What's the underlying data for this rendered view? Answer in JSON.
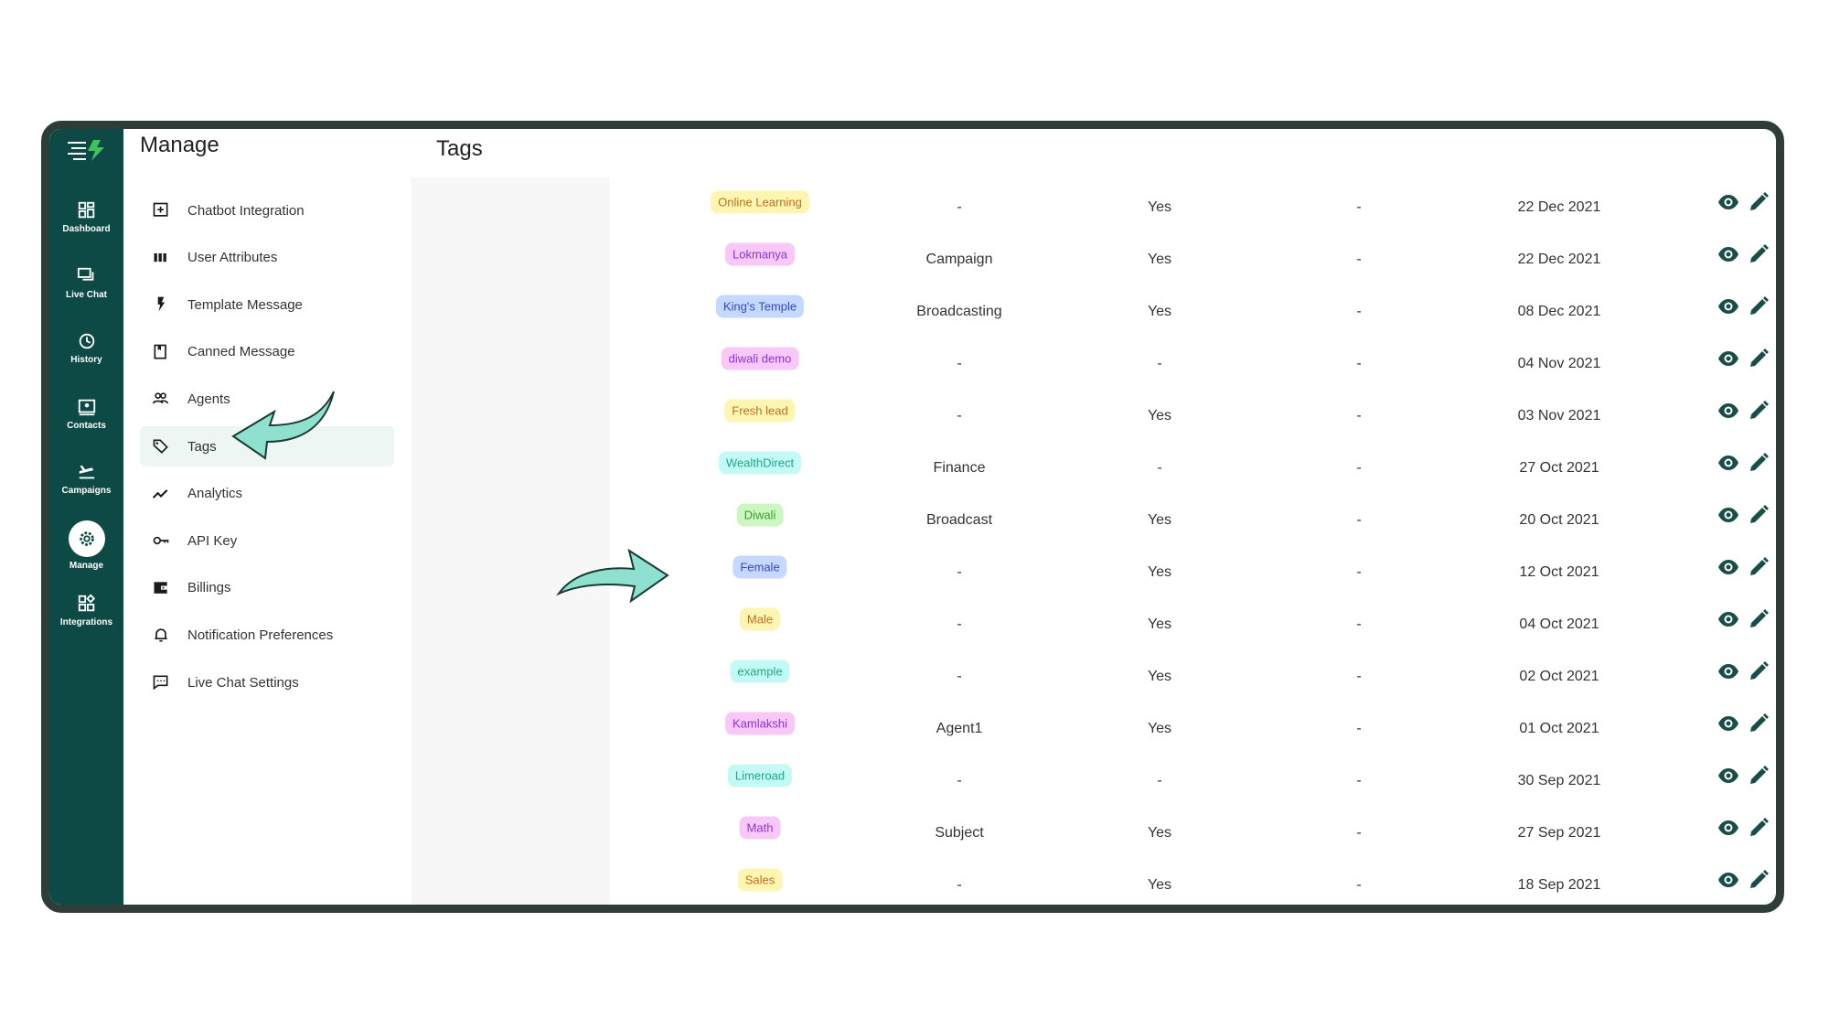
{
  "rail": [
    {
      "label": "Dashboard",
      "icon": "dashboard-icon"
    },
    {
      "label": "Live Chat",
      "icon": "chat-icon"
    },
    {
      "label": "History",
      "icon": "history-icon"
    },
    {
      "label": "Contacts",
      "icon": "contacts-icon"
    },
    {
      "label": "Campaigns",
      "icon": "campaigns-icon"
    },
    {
      "label": "Manage",
      "icon": "gear-icon",
      "active": true
    },
    {
      "label": "Integrations",
      "icon": "integrations-icon"
    }
  ],
  "menu": {
    "title": "Manage",
    "items": [
      {
        "label": "Chatbot Integration",
        "icon": "chatbot-icon"
      },
      {
        "label": "User Attributes",
        "icon": "attributes-icon"
      },
      {
        "label": "Template Message",
        "icon": "bolt-icon"
      },
      {
        "label": "Canned Message",
        "icon": "bookmark-icon"
      },
      {
        "label": "Agents",
        "icon": "agents-icon"
      },
      {
        "label": "Tags",
        "icon": "tag-icon",
        "active": true
      },
      {
        "label": "Analytics",
        "icon": "analytics-icon"
      },
      {
        "label": "API Key",
        "icon": "key-icon"
      },
      {
        "label": "Billings",
        "icon": "wallet-icon"
      },
      {
        "label": "Notification Preferences",
        "icon": "bell-icon"
      },
      {
        "label": "Live Chat Settings",
        "icon": "chat-settings-icon"
      }
    ]
  },
  "page": {
    "title": "Tags"
  },
  "colors": {
    "rail": "#0e4a45",
    "frame": "#2e3d38",
    "icon": "#1a4d47",
    "arrow": "#8fe0cf"
  },
  "tag_styles": {
    "yellow": {
      "bg": "#fdf6b3",
      "fg": "#c0701e"
    },
    "pink": {
      "bg": "#f8c8f8",
      "fg": "#8a35d8"
    },
    "blue": {
      "bg": "#c5d8ff",
      "fg": "#3448c8"
    },
    "cyan": {
      "bg": "#c3faf5",
      "fg": "#1ea98a"
    },
    "green": {
      "bg": "#cdf7c2",
      "fg": "#3b9a2c"
    }
  },
  "rows": [
    {
      "tag": "Online Learning",
      "style": "yellow",
      "c2": "-",
      "c3": "Yes",
      "c4": "-",
      "date": "22 Dec 2021"
    },
    {
      "tag": "Lokmanya",
      "style": "pink",
      "c2": "Campaign",
      "c3": "Yes",
      "c4": "-",
      "date": "22 Dec 2021"
    },
    {
      "tag": "King's Temple",
      "style": "blue",
      "c2": "Broadcasting",
      "c3": "Yes",
      "c4": "-",
      "date": "08 Dec 2021"
    },
    {
      "tag": "diwali demo",
      "style": "pink",
      "c2": "-",
      "c3": "-",
      "c4": "-",
      "date": "04 Nov 2021"
    },
    {
      "tag": "Fresh lead",
      "style": "yellow",
      "c2": "-",
      "c3": "Yes",
      "c4": "-",
      "date": "03 Nov 2021"
    },
    {
      "tag": "WealthDirect",
      "style": "cyan",
      "c2": "Finance",
      "c3": "-",
      "c4": "-",
      "date": "27 Oct 2021"
    },
    {
      "tag": "Diwali",
      "style": "green",
      "c2": "Broadcast",
      "c3": "Yes",
      "c4": "-",
      "date": "20 Oct 2021"
    },
    {
      "tag": "Female",
      "style": "blue",
      "c2": "-",
      "c3": "Yes",
      "c4": "-",
      "date": "12 Oct 2021"
    },
    {
      "tag": "Male",
      "style": "yellow",
      "c2": "-",
      "c3": "Yes",
      "c4": "-",
      "date": "04 Oct 2021"
    },
    {
      "tag": "example",
      "style": "cyan",
      "c2": "-",
      "c3": "Yes",
      "c4": "-",
      "date": "02 Oct 2021"
    },
    {
      "tag": "Kamlakshi",
      "style": "pink",
      "c2": "Agent1",
      "c3": "Yes",
      "c4": "-",
      "date": "01 Oct 2021"
    },
    {
      "tag": "Limeroad",
      "style": "cyan",
      "c2": "-",
      "c3": "-",
      "c4": "-",
      "date": "30 Sep 2021"
    },
    {
      "tag": "Math",
      "style": "pink",
      "c2": "Subject",
      "c3": "Yes",
      "c4": "-",
      "date": "27 Sep 2021"
    },
    {
      "tag": "Sales",
      "style": "yellow",
      "c2": "-",
      "c3": "Yes",
      "c4": "-",
      "date": "18 Sep 2021"
    }
  ]
}
